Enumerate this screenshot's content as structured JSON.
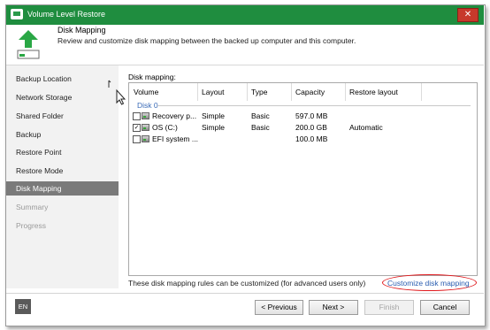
{
  "window": {
    "title": "Volume Level Restore",
    "close_glyph": "✕"
  },
  "header": {
    "title": "Disk Mapping",
    "description": "Review and customize disk mapping between the backed up computer and this computer.",
    "icon": "restore-up-arrow-icon"
  },
  "nav": {
    "items": [
      {
        "label": "Backup Location",
        "state": "normal"
      },
      {
        "label": "Network Storage",
        "state": "normal"
      },
      {
        "label": "Shared Folder",
        "state": "normal"
      },
      {
        "label": "Backup",
        "state": "normal"
      },
      {
        "label": "Restore Point",
        "state": "normal"
      },
      {
        "label": "Restore Mode",
        "state": "normal"
      },
      {
        "label": "Disk Mapping",
        "state": "active"
      },
      {
        "label": "Summary",
        "state": "disabled"
      },
      {
        "label": "Progress",
        "state": "disabled"
      }
    ]
  },
  "main": {
    "section_label": "Disk mapping:",
    "columns": [
      "Volume",
      "Layout",
      "Type",
      "Capacity",
      "Restore layout"
    ],
    "group": "Disk 0",
    "rows": [
      {
        "checked": false,
        "volume": "Recovery p...",
        "layout": "Simple",
        "type": "Basic",
        "capacity": "597.0 MB",
        "restore_layout": ""
      },
      {
        "checked": true,
        "volume": "OS (C:)",
        "layout": "Simple",
        "type": "Basic",
        "capacity": "200.0 GB",
        "restore_layout": "Automatic"
      },
      {
        "checked": false,
        "volume": "EFI system ...",
        "layout": "",
        "type": "",
        "capacity": "100.0 MB",
        "restore_layout": ""
      }
    ],
    "note": "These disk mapping rules can be customized (for advanced users only)",
    "customize_link": "Customize disk mapping"
  },
  "footer": {
    "language": "EN",
    "previous": "< Previous",
    "next": "Next >",
    "finish": "Finish",
    "cancel": "Cancel"
  },
  "colors": {
    "titlebar": "#1f8d3f",
    "active_nav": "#7a7a7a",
    "link": "#2a5db0",
    "highlight_circle": "#e0191d"
  }
}
